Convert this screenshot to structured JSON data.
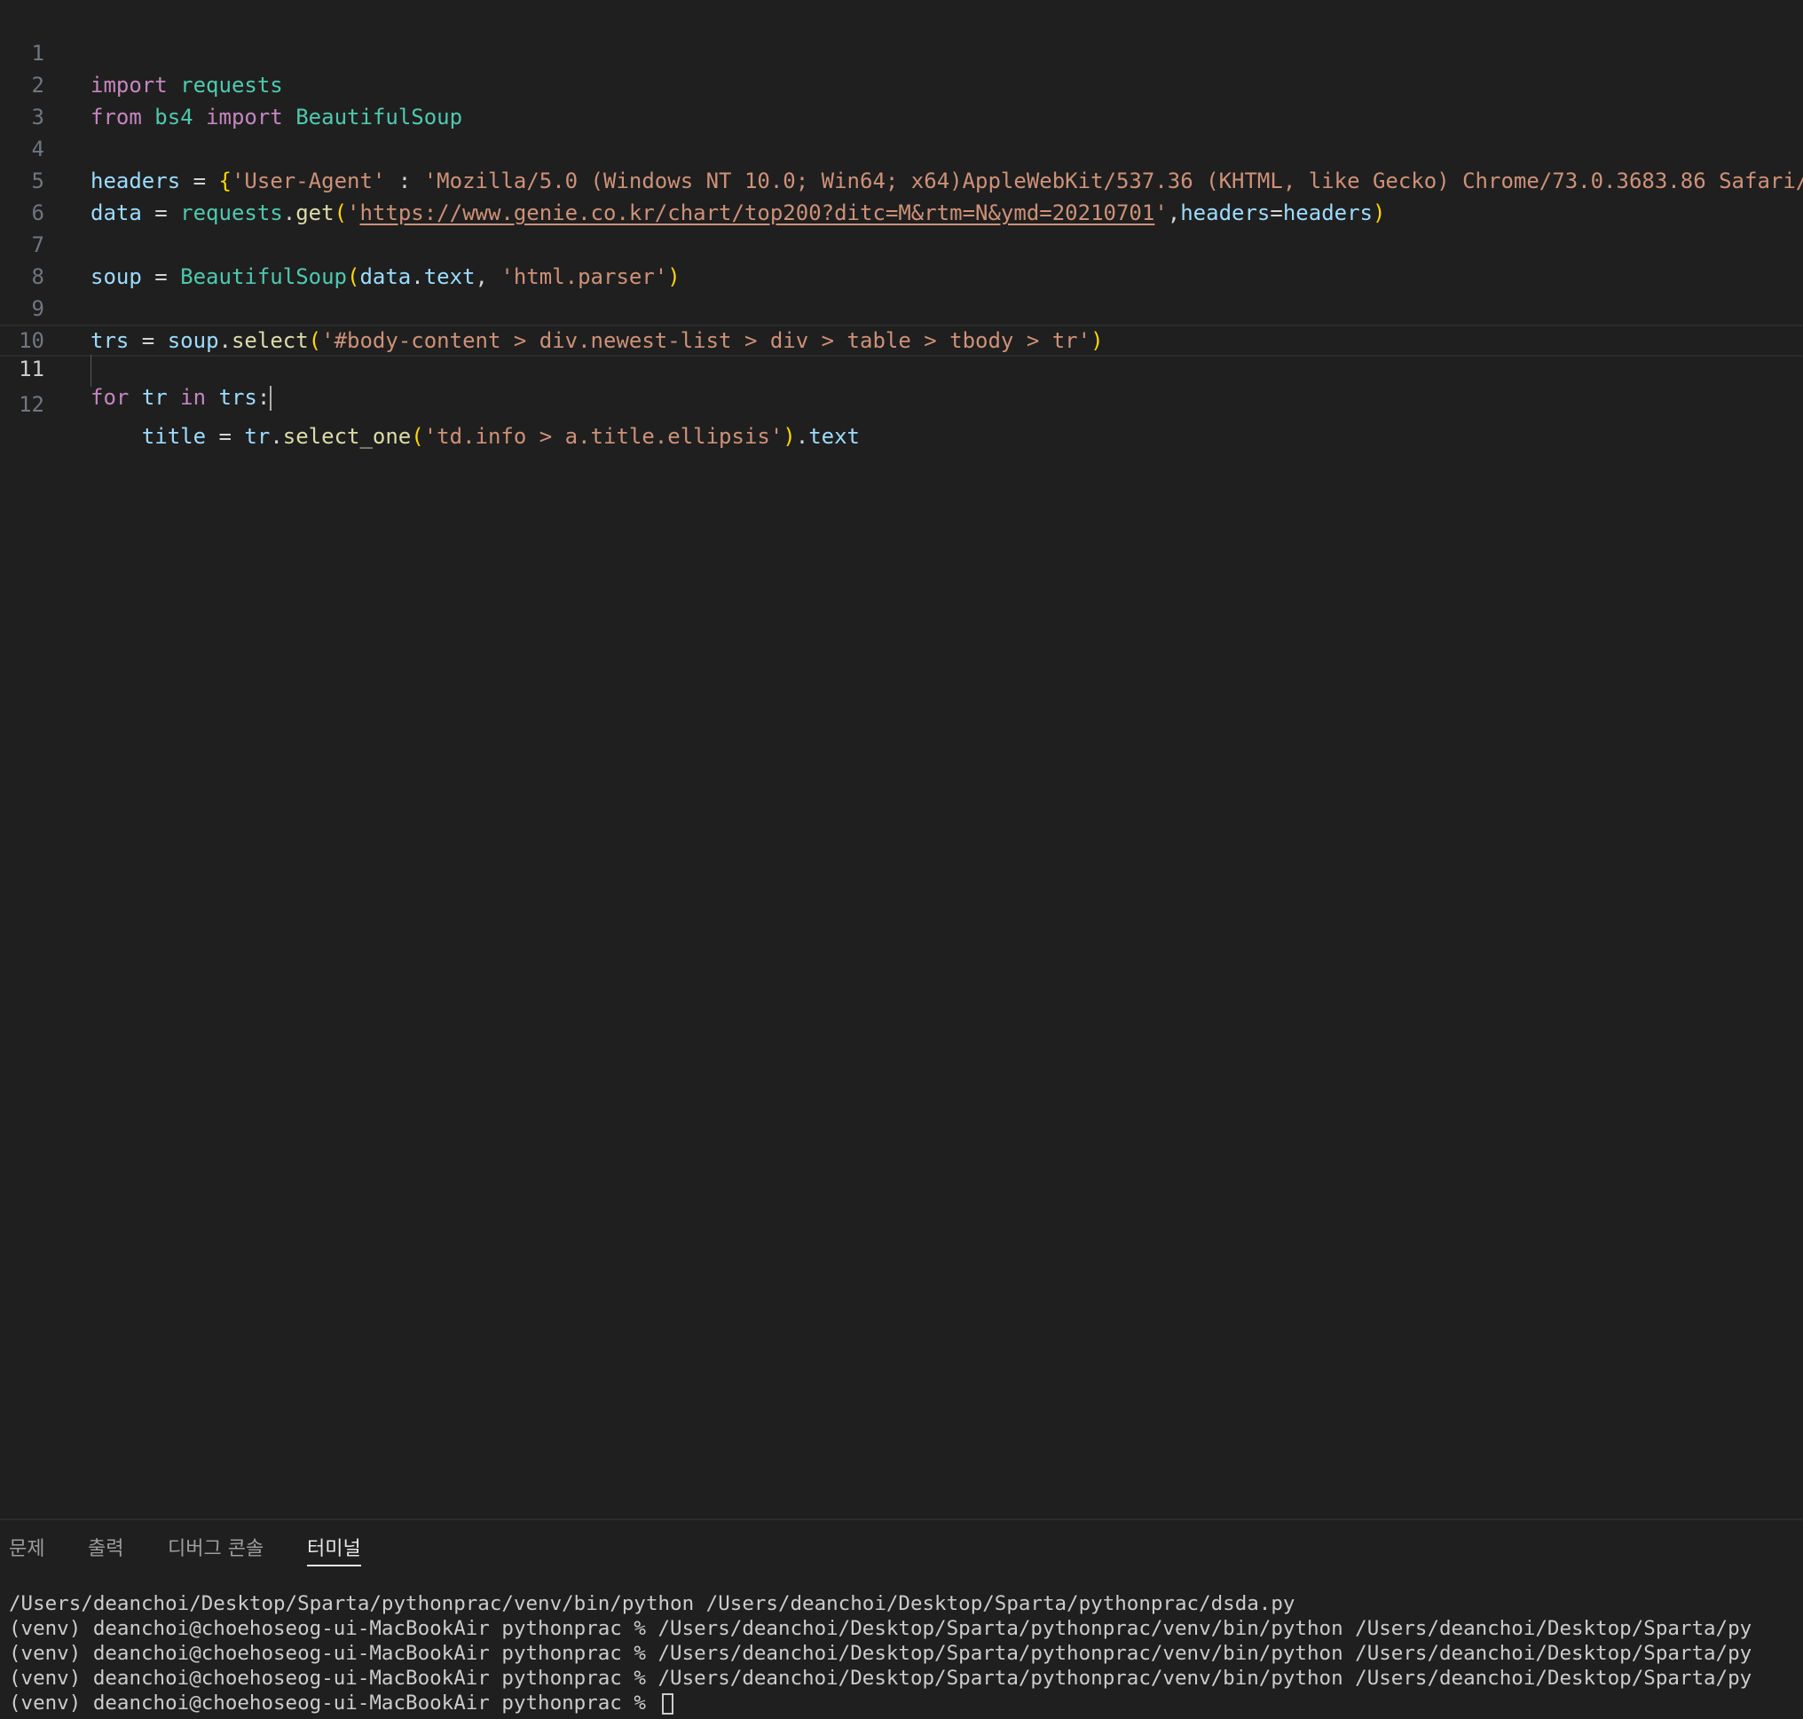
{
  "editor": {
    "line_numbers": [
      "1",
      "2",
      "3",
      "4",
      "5",
      "6",
      "7",
      "8",
      "9",
      "10",
      "11",
      "12"
    ],
    "line1": {
      "kw": "import",
      "mod": "requests"
    },
    "line2": {
      "kw1": "from",
      "mod1": "bs4",
      "kw2": "import",
      "mod2": "BeautifulSoup"
    },
    "line4": {
      "var": "headers",
      "op": " = ",
      "open": "{",
      "key": "'User-Agent'",
      "colon": " : ",
      "value": "'Mozilla/5.0 (Windows NT 10.0; Win64; x64)AppleWebKit/537.36 (KHTML, like Gecko) Chrome/73.0.3683.86 Safari/"
    },
    "line5": {
      "var": "data",
      "op": " = ",
      "mod": "requests",
      "dot": ".",
      "fn": "get",
      "open": "(",
      "q1": "'",
      "url": "https://www.genie.co.kr/chart/top200?ditc=M&rtm=N&ymd=20210701",
      "q2": "'",
      "comma": ",",
      "kwarg": "headers",
      "eq": "=",
      "argval": "headers",
      "close": ")"
    },
    "line7": {
      "var": "soup",
      "op": " = ",
      "cls": "BeautifulSoup",
      "open": "(",
      "arg1": "data",
      "dot": ".",
      "attr": "text",
      "comma": ", ",
      "str": "'html.parser'",
      "close": ")"
    },
    "line9": {
      "var": "trs",
      "op": " = ",
      "obj": "soup",
      "dot": ".",
      "fn": "select",
      "open": "(",
      "str": "'#body-content > div.newest-list > div > table > tbody > tr'",
      "close": ")"
    },
    "line11": {
      "kw1": "for",
      "v1": "tr",
      "kw2": "in",
      "v2": "trs",
      "colon": ":"
    },
    "line12": {
      "indent": "    ",
      "var": "title",
      "op": " = ",
      "obj": "tr",
      "dot": ".",
      "fn": "select_one",
      "open": "(",
      "str": "'td.info > a.title.ellipsis'",
      "close": ")",
      "dot2": ".",
      "attr": "text"
    }
  },
  "panel": {
    "tabs": [
      {
        "label": "문제"
      },
      {
        "label": "출력"
      },
      {
        "label": "디버그 콘솔"
      },
      {
        "label": "터미널"
      }
    ],
    "terminal_lines": [
      "/Users/deanchoi/Desktop/Sparta/pythonprac/venv/bin/python /Users/deanchoi/Desktop/Sparta/pythonprac/dsda.py",
      "(venv) deanchoi@choehoseog-ui-MacBookAir pythonprac % /Users/deanchoi/Desktop/Sparta/pythonprac/venv/bin/python /Users/deanchoi/Desktop/Sparta/py",
      "(venv) deanchoi@choehoseog-ui-MacBookAir pythonprac % /Users/deanchoi/Desktop/Sparta/pythonprac/venv/bin/python /Users/deanchoi/Desktop/Sparta/py",
      "(venv) deanchoi@choehoseog-ui-MacBookAir pythonprac % /Users/deanchoi/Desktop/Sparta/pythonprac/venv/bin/python /Users/deanchoi/Desktop/Sparta/py",
      "(venv) deanchoi@choehoseog-ui-MacBookAir pythonprac % "
    ]
  },
  "colors": {
    "background": "#1f1f1f",
    "keyword": "#c586c0",
    "module": "#4ec9b0",
    "variable": "#9cdcfe",
    "function": "#dcdcaa",
    "string": "#ce9178",
    "bracket": "#ffd700",
    "line_number": "#6e7681",
    "text": "#cccccc"
  }
}
